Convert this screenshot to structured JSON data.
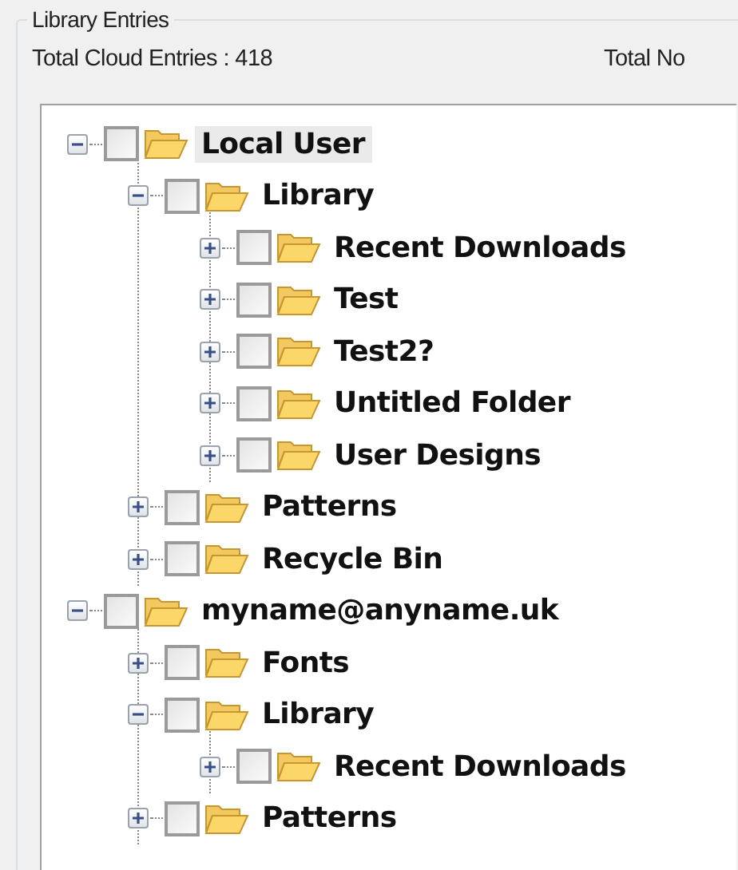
{
  "group_title": "Library Entries",
  "totals": [
    "Total Cloud Entries : 418",
    "Total No"
  ],
  "tree": [
    {
      "label": "Local User",
      "expanded": true,
      "checked": false,
      "selected": true,
      "children": [
        {
          "label": "Library",
          "expanded": true,
          "checked": false,
          "selected": false,
          "children": [
            {
              "label": "Recent Downloads",
              "expanded": false,
              "checked": false,
              "selected": false
            },
            {
              "label": "Test",
              "expanded": false,
              "checked": false,
              "selected": false
            },
            {
              "label": "Test2?",
              "expanded": false,
              "checked": false,
              "selected": false
            },
            {
              "label": "Untitled Folder",
              "expanded": false,
              "checked": false,
              "selected": false
            },
            {
              "label": "User Designs",
              "expanded": false,
              "checked": false,
              "selected": false
            }
          ]
        },
        {
          "label": "Patterns",
          "expanded": false,
          "checked": false,
          "selected": false
        },
        {
          "label": "Recycle Bin",
          "expanded": false,
          "checked": false,
          "selected": false
        }
      ]
    },
    {
      "label": "myname@anyname.uk",
      "expanded": true,
      "checked": false,
      "selected": false,
      "children": [
        {
          "label": "Fonts",
          "expanded": false,
          "checked": false,
          "selected": false
        },
        {
          "label": "Library",
          "expanded": true,
          "checked": false,
          "selected": false,
          "children": [
            {
              "label": "Recent Downloads",
              "expanded": false,
              "checked": false,
              "selected": false
            }
          ]
        },
        {
          "label": "Patterns",
          "expanded": false,
          "checked": false,
          "selected": false
        }
      ]
    }
  ]
}
